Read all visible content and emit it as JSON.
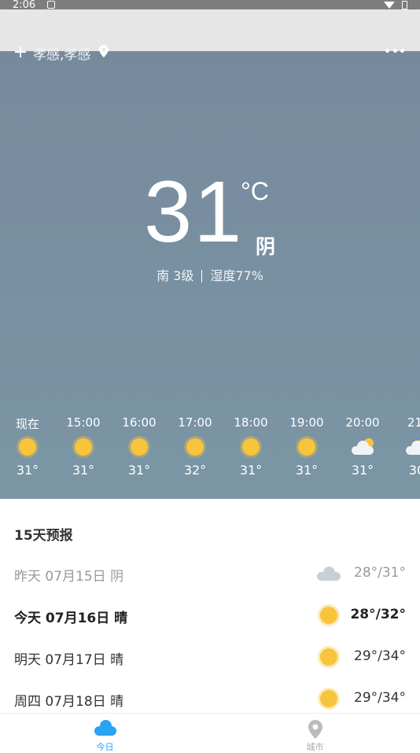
{
  "status_bar": {
    "time": "2:06"
  },
  "header": {
    "city": "孝感,孝感"
  },
  "current": {
    "temperature": "31",
    "unit": "°C",
    "condition": "阴",
    "wind": "南 3级",
    "humidity": "湿度77%"
  },
  "hourly": [
    {
      "time": "现在",
      "icon": "sun-icon",
      "temp": "31°"
    },
    {
      "time": "15:00",
      "icon": "sun-icon",
      "temp": "31°"
    },
    {
      "time": "16:00",
      "icon": "sun-icon",
      "temp": "31°"
    },
    {
      "time": "17:00",
      "icon": "sun-icon",
      "temp": "32°"
    },
    {
      "time": "18:00",
      "icon": "sun-icon",
      "temp": "31°"
    },
    {
      "time": "19:00",
      "icon": "sun-icon",
      "temp": "31°"
    },
    {
      "time": "20:00",
      "icon": "partly-cloudy-icon",
      "temp": "31°"
    },
    {
      "time": "21:",
      "icon": "partly-cloudy-icon",
      "temp": "30"
    }
  ],
  "forecast": {
    "title": "15天预报",
    "days": [
      {
        "label": "昨天 07月15日 阴",
        "icon": "cloud-icon",
        "range": "28°/31°"
      },
      {
        "label": "今天 07月16日 晴",
        "icon": "sun-icon",
        "range": "28°/32°"
      },
      {
        "label": "明天 07月17日 晴",
        "icon": "sun-icon",
        "range": "29°/34°"
      },
      {
        "label": "周四 07月18日 晴",
        "icon": "sun-icon",
        "range": "29°/34°"
      }
    ]
  },
  "nav": {
    "tabs": [
      {
        "label": "今日",
        "icon": "cloud-icon"
      },
      {
        "label": "城市",
        "icon": "location-pin-icon"
      }
    ]
  },
  "colors": {
    "hero_bg": "#778a9d",
    "accent": "#29a3f2",
    "sun": "#f7c43b"
  }
}
